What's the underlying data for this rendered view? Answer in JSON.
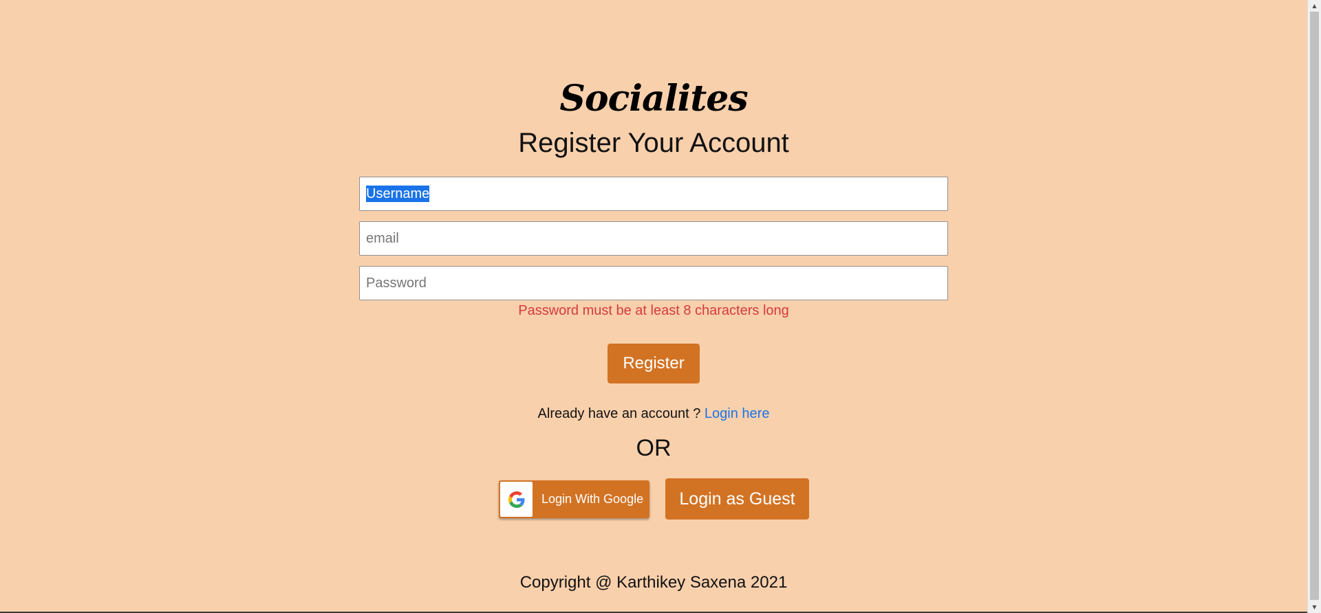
{
  "app": {
    "brand": "Socialites",
    "subtitle": "Register Your Account"
  },
  "form": {
    "username": {
      "value": "Username",
      "placeholder": "Username"
    },
    "email": {
      "placeholder": "email"
    },
    "password": {
      "placeholder": "Password"
    },
    "error_message": "Password must be at least 8 characters long",
    "register_label": "Register"
  },
  "login": {
    "prompt": "Already have an account ?",
    "link_label": "Login here",
    "or_label": "OR",
    "google_label": "Login With Google",
    "google_icon": "google-logo-icon",
    "guest_label": "Login as Guest"
  },
  "footer": {
    "copyright": "Copyright @ Karthikey Saxena 2021"
  },
  "colors": {
    "background": "#f9d0ac",
    "accent": "#d27324",
    "error": "#d33b3b",
    "link": "#1a73e8",
    "selection": "#1a73e8"
  }
}
